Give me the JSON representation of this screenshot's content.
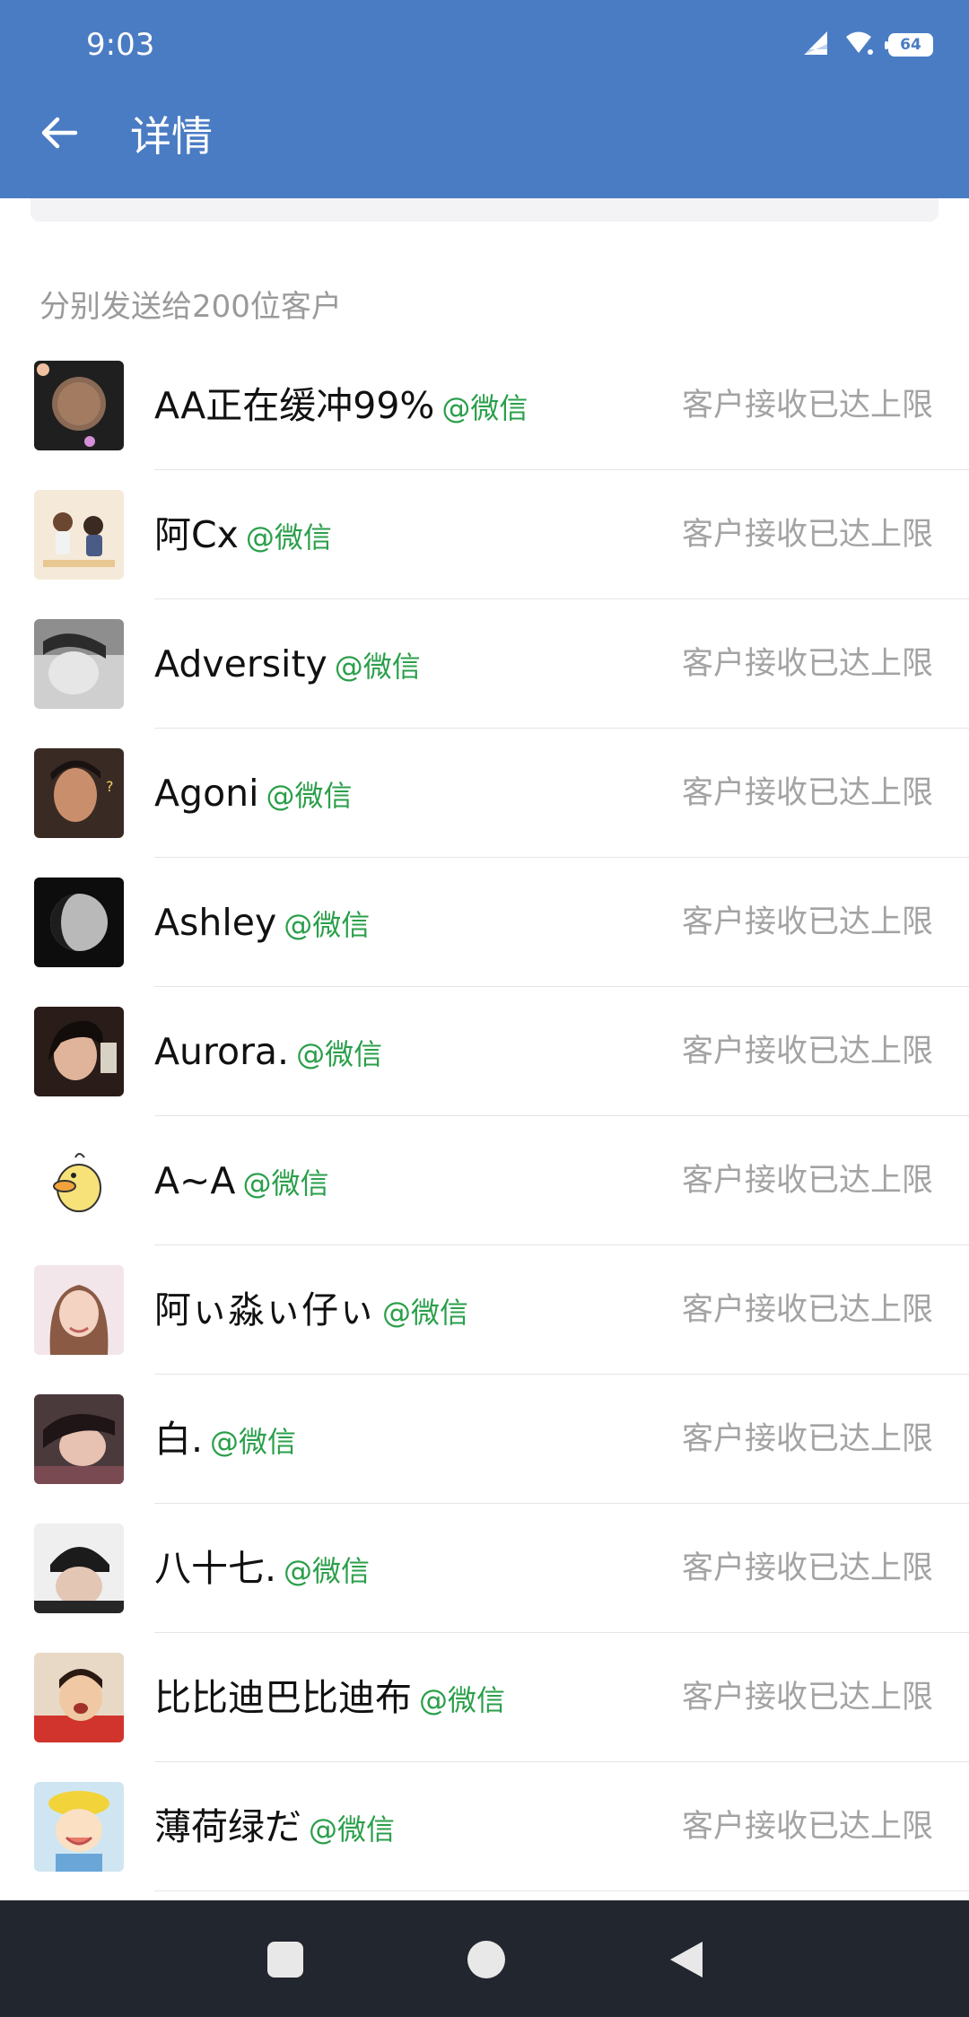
{
  "status_bar": {
    "time": "9:03",
    "battery": "64",
    "icons": [
      "signal-icon",
      "wifi-icon",
      "battery-icon"
    ]
  },
  "header": {
    "title": "详情",
    "back_icon": "back-arrow-icon"
  },
  "section": {
    "label": "分别发送给200位客户"
  },
  "customers": [
    {
      "name": "AA正在缓冲99%",
      "source": "@微信",
      "status": "客户接收已达上限"
    },
    {
      "name": "阿Cx",
      "source": "@微信",
      "status": "客户接收已达上限"
    },
    {
      "name": "Adversity",
      "source": "@微信",
      "status": "客户接收已达上限"
    },
    {
      "name": "Agoni",
      "source": "@微信",
      "status": "客户接收已达上限"
    },
    {
      "name": "Ashley",
      "source": "@微信",
      "status": "客户接收已达上限"
    },
    {
      "name": "Aurora.",
      "source": "@微信",
      "status": "客户接收已达上限"
    },
    {
      "name": "A~A",
      "source": "@微信",
      "status": "客户接收已达上限"
    },
    {
      "name": "阿ぃ淼ぃ仔ぃ",
      "source": "@微信",
      "status": "客户接收已达上限"
    },
    {
      "name": "白.",
      "source": "@微信",
      "status": "客户接收已达上限"
    },
    {
      "name": "八十七.",
      "source": "@微信",
      "status": "客户接收已达上限"
    },
    {
      "name": "比比迪巴比迪布",
      "source": "@微信",
      "status": "客户接收已达上限"
    },
    {
      "name": "薄荷绿だ",
      "source": "@微信",
      "status": "客户接收已达上限"
    }
  ],
  "nav_bar": {
    "buttons": [
      "recents-square-icon",
      "home-circle-icon",
      "back-triangle-icon"
    ]
  },
  "colors": {
    "app_bar": "#4a7cc4",
    "source_tag": "#2a9f4a",
    "status_text": "#a3a3a3",
    "nav_bar": "#22262e"
  }
}
